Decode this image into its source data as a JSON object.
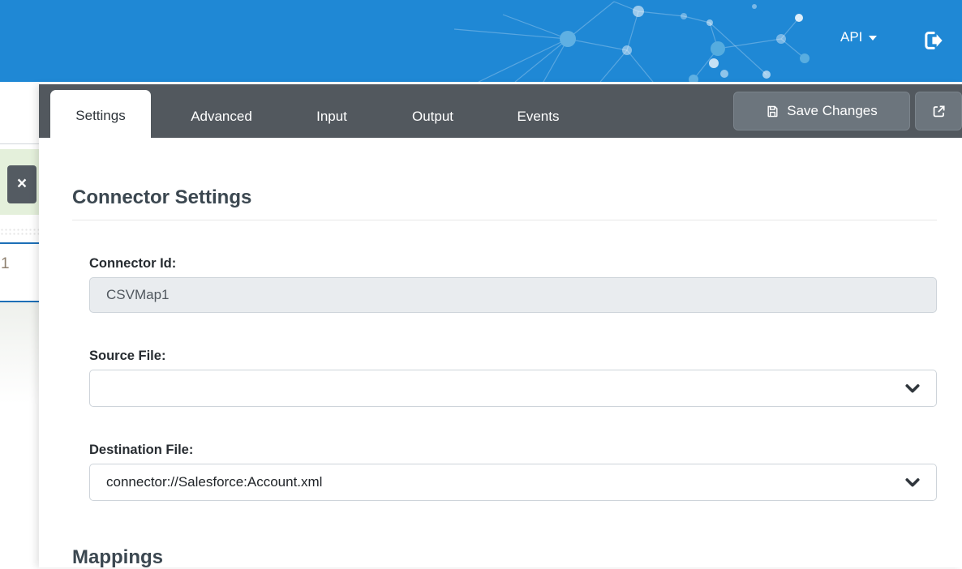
{
  "header": {
    "api_menu_label": "API",
    "bg_color": "#1f88d5",
    "icons": {
      "menu_caret": "caret-down-icon",
      "logout": "sign-out-icon"
    }
  },
  "background_page": {
    "close_button_glyph": "×",
    "partial_row_text": "1",
    "highlight_color": "#e4f0db",
    "selection_border_color": "#1d6fb7"
  },
  "tab_bar": {
    "bg_color": "#52585e",
    "tabs": [
      {
        "label": "Settings",
        "active": true
      },
      {
        "label": "Advanced",
        "active": false
      },
      {
        "label": "Input",
        "active": false
      },
      {
        "label": "Output",
        "active": false
      },
      {
        "label": "Events",
        "active": false
      }
    ],
    "save_button": {
      "label": "Save Changes",
      "icon": "floppy-disk-icon"
    },
    "open_external_button": {
      "icon": "external-link-icon"
    }
  },
  "content": {
    "section_title": "Connector Settings",
    "fields": {
      "connector_id": {
        "label": "Connector Id:",
        "value": "CSVMap1",
        "disabled": true
      },
      "source_file": {
        "label": "Source File:",
        "value": ""
      },
      "destination_file": {
        "label": "Destination File:",
        "value": "connector://Salesforce:Account.xml"
      }
    },
    "mappings_title": "Mappings"
  }
}
